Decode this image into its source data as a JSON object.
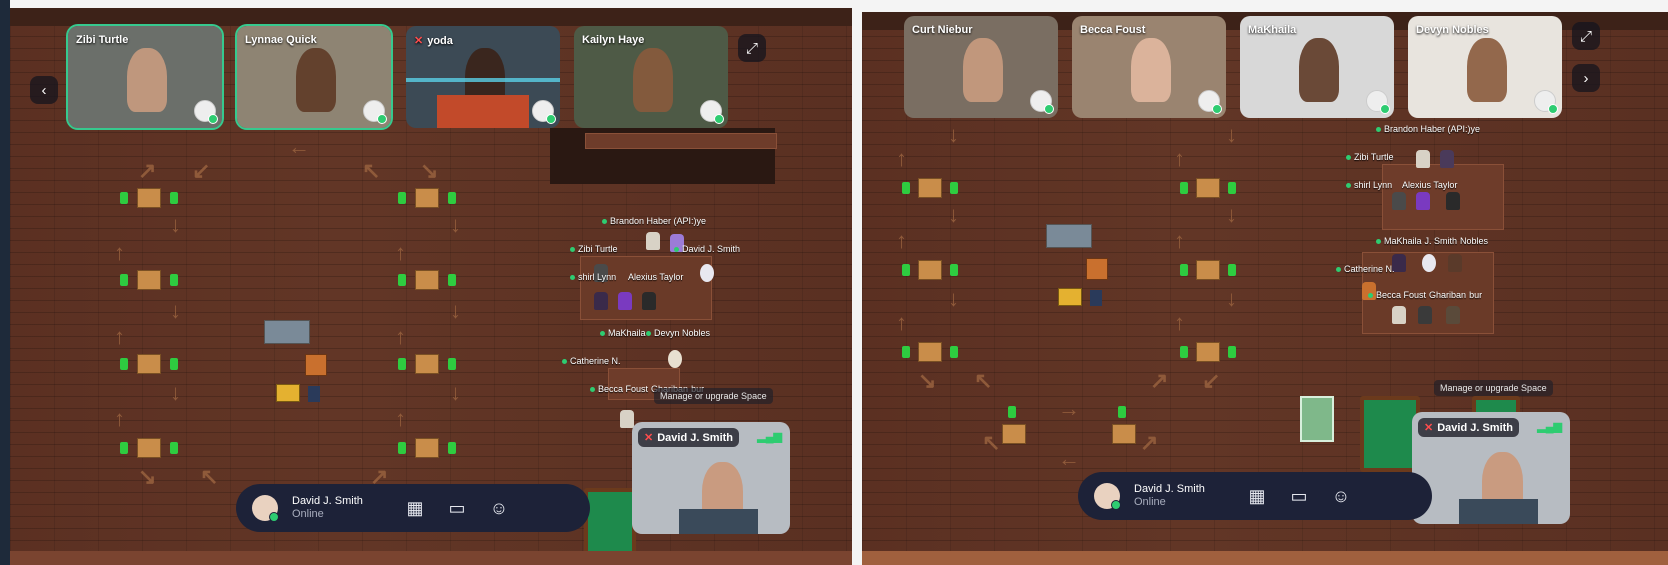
{
  "left": {
    "tiles": [
      {
        "name": "Zibi Turtle",
        "muted": false,
        "active": true
      },
      {
        "name": "Lynnae Quick",
        "muted": false,
        "active": true
      },
      {
        "name": "yoda",
        "muted": true,
        "active": false
      },
      {
        "name": "Kailyn Haye",
        "muted": false,
        "active": false
      }
    ],
    "map_labels": {
      "brandon": "Brandon Haber (API:)ye",
      "zibi": "Zibi Turtle",
      "david": "David J. Smith",
      "shirl": "shirl Lynn",
      "alexius": "Alexius Taylor",
      "makhaila": "MaKhaila",
      "devyn": "Devyn Nobles",
      "catherine": "Catherine N.",
      "becca": "Becca Foust",
      "ghariban": "Ghariban",
      "bur": "bur"
    },
    "tooltip": "Manage or upgrade Space",
    "self_view": {
      "name": "David J. Smith"
    },
    "bar": {
      "user": "David J. Smith",
      "status": "Online"
    }
  },
  "right": {
    "tiles": [
      {
        "name": "Curt Niebur"
      },
      {
        "name": "Becca Foust"
      },
      {
        "name": "MaKhaila"
      },
      {
        "name": "Devyn Nobles"
      }
    ],
    "map_labels": {
      "brandon": "Brandon Haber (API:)ye",
      "zibi": "Zibi Turtle",
      "shirl": "shirl Lynn",
      "alexius": "Alexius Taylor",
      "makhaila": "MaKhaila",
      "jsmith": "J. Smith",
      "nobles": "Nobles",
      "catherine": "Catherine N.",
      "becca": "Becca Foust",
      "ghariban": "Ghariban",
      "bur": "bur"
    },
    "tooltip": "Manage or upgrade Space",
    "self_view": {
      "name": "David J. Smith"
    },
    "bar": {
      "user": "David J. Smith",
      "status": "Online"
    }
  },
  "icons": {
    "prev": "chevron-left-icon",
    "next": "chevron-right-icon",
    "expand": "expand-icon",
    "map": "map-icon",
    "screen": "screen-share-icon",
    "emoji": "emoji-icon",
    "mic_off": "mic-off-icon",
    "signal": "signal-icon"
  },
  "colors": {
    "online": "#2ecc71",
    "active_border": "#36c98e",
    "bar_bg": "#1d2238",
    "floor": "#5a2f22"
  }
}
